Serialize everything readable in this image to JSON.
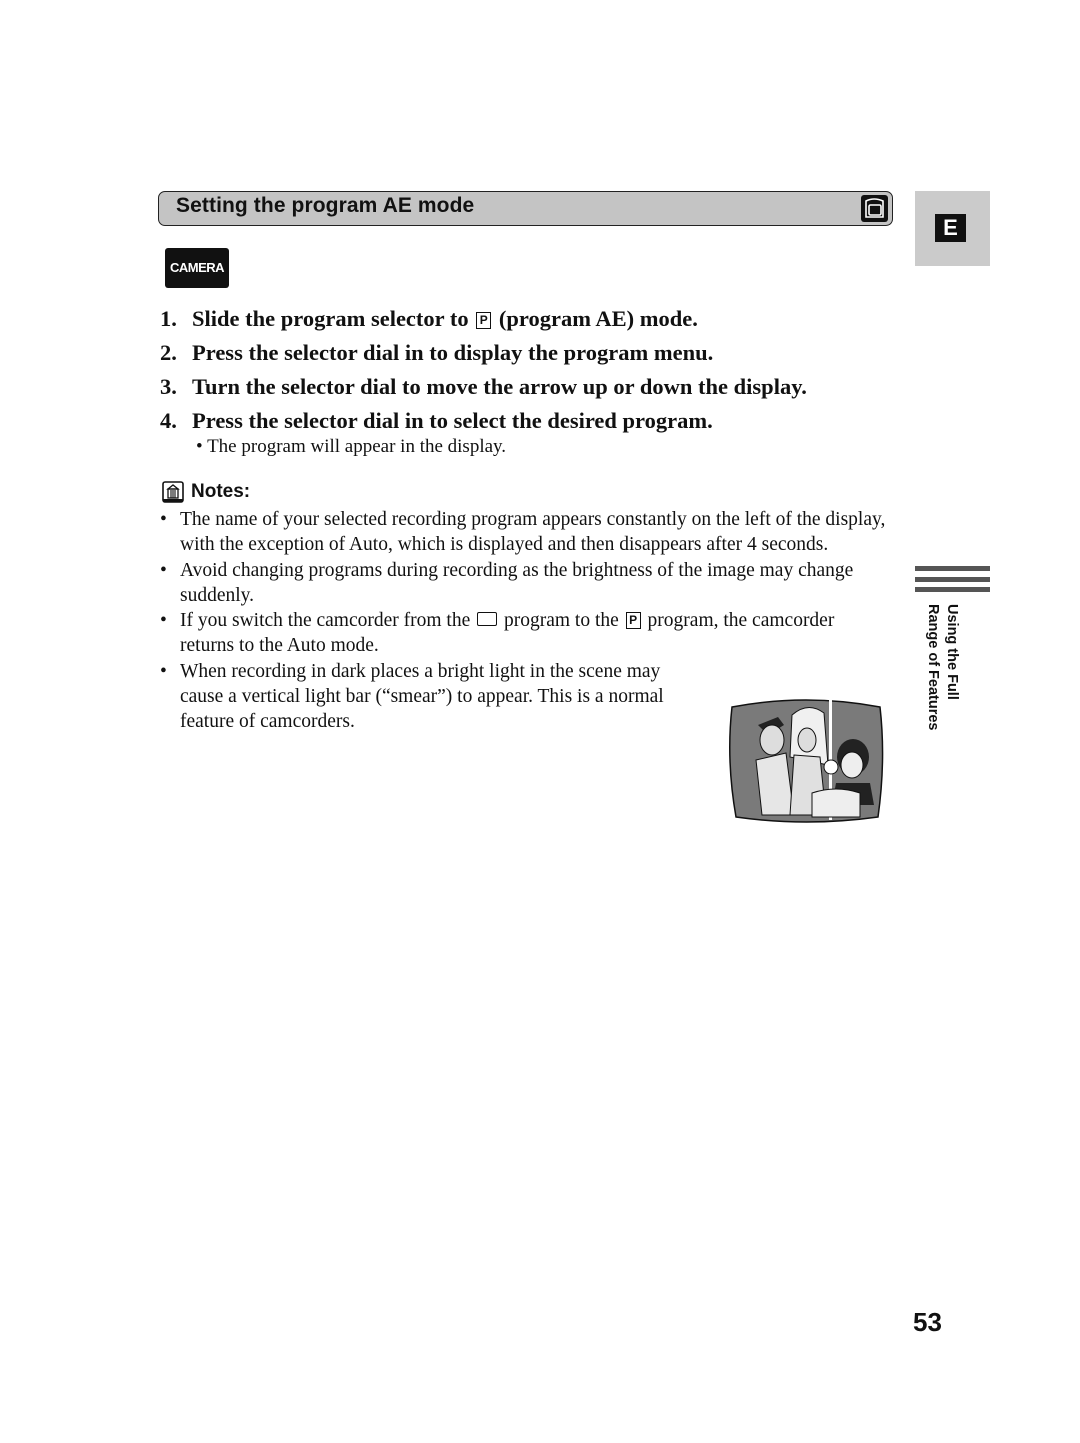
{
  "section": {
    "title": "Setting the program AE mode",
    "icon": "camcorder-icon"
  },
  "language_tab": "E",
  "mode_badge": "CAMERA",
  "steps": [
    {
      "num": "1.",
      "before": "Slide the program selector to",
      "icon": "P",
      "after": "(program AE) mode."
    },
    {
      "num": "2.",
      "text": "Press the selector dial in to display the program menu."
    },
    {
      "num": "3.",
      "text": "Turn the selector dial to move the arrow up or down the display."
    },
    {
      "num": "4.",
      "text": "Press the selector dial in to select the desired program."
    }
  ],
  "step_sub_bullet": "The program will appear in the display.",
  "notes": {
    "heading": "Notes:",
    "items": [
      {
        "text": "The name of your selected recording program appears constantly on the left of the display, with the exception of Auto, which is displayed and then disappears after 4 seconds."
      },
      {
        "text": "Avoid changing programs during recording as the brightness of the image may change suddenly."
      },
      {
        "before": "If you switch the camcorder from the",
        "middle": "program to the",
        "icon": "P",
        "after": "program, the camcorder returns to the Auto mode."
      },
      {
        "text": "When recording in dark places a bright light in the scene may cause a vertical light bar (“smear”) to appear. This is a normal feature of camcorders."
      }
    ]
  },
  "bullet": "•",
  "side_label": {
    "line1": "Using the Full",
    "line2": "Range of Features"
  },
  "page_number": "53"
}
